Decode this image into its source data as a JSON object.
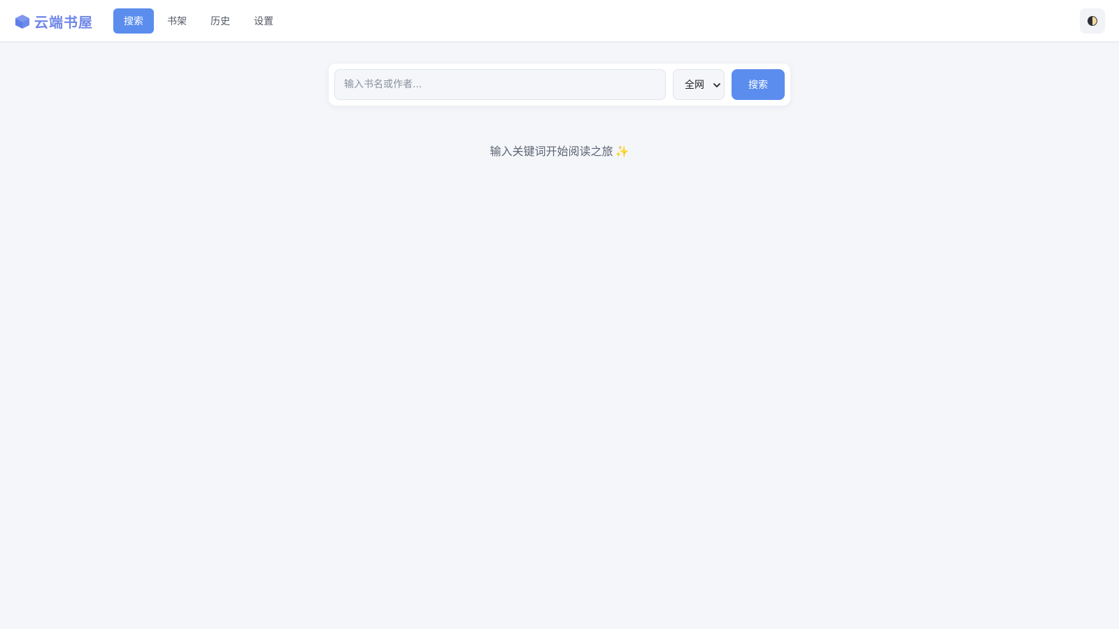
{
  "app": {
    "title": "云端书屋",
    "brand_icon": "cube-icon",
    "accent_color": "#5b8dee"
  },
  "nav": {
    "items": [
      {
        "label": "搜索",
        "active": true
      },
      {
        "label": "书架",
        "active": false
      },
      {
        "label": "历史",
        "active": false
      },
      {
        "label": "设置",
        "active": false
      }
    ]
  },
  "header": {
    "theme_toggle_icon": "contrast-icon"
  },
  "search": {
    "placeholder": "输入书名或作者...",
    "value": "",
    "scope_selected": "全网",
    "button_label": "搜索"
  },
  "empty_state": {
    "message": "输入关键词开始阅读之旅",
    "emoji": "✨"
  }
}
